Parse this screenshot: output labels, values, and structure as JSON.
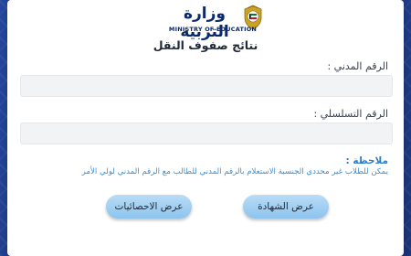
{
  "header": {
    "logo_arabic": "وزارة التربية",
    "logo_english": "MINISTRY OF EDUCATION",
    "emblem_icon": "kuwait-emblem-icon",
    "page_title": "نتائج صفوف النقل"
  },
  "form": {
    "civil_id_label": "الرقم المدني :",
    "civil_id_value": "",
    "serial_label": "الرقم التسلسلي :",
    "serial_value": ""
  },
  "note": {
    "title": "ملاحظة :",
    "text": "يمكن للطلاب غير محددي الجنسية الاستعلام بالرقم المدني للطالب مع الرقم المدني لولي الأمر"
  },
  "buttons": {
    "certificate_label": "عرض الشهادة",
    "statistics_label": "عرض الاحصائيات"
  },
  "colors": {
    "background": "#1e3a8a",
    "note_color": "#3b8fd4",
    "button_color": "#9fcff2"
  }
}
